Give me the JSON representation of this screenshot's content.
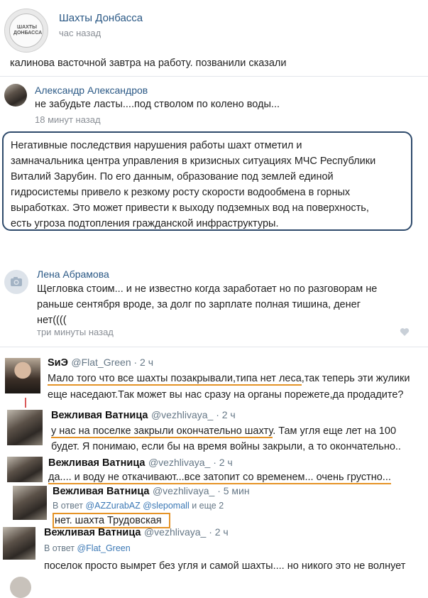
{
  "post1": {
    "author": "Шахты Донбасса",
    "logo_text": "ШАХТЫ ДОНБАССА",
    "time": "час назад",
    "text": "калинова васточной завтра на работу. позванили сказали"
  },
  "comment1": {
    "author": "Александр Александров",
    "text": "не забудьте ласты....под стволом по колено воды...",
    "time": "18 минут назад"
  },
  "quote": {
    "lines": [
      "Негативные последствия нарушения работы шахт отметил и",
      "замначальника центра управления в кризисных ситуациях МЧС Республики",
      "Виталий Зарубин. По его данным, образование под землей единой",
      "гидросистемы привело к резкому росту скорости водообмена в горных",
      "выработках. Это может привести к выходу подземных вод на поверхность,",
      "есть угроза подтопления гражданской инфраструктуры."
    ]
  },
  "comment2": {
    "author": "Лена Абрамова",
    "lines": [
      "Щегловка стоим... и не известно когда заработает но по разговорам не",
      "раньше сентября вроде, за долг по зарплате полная тишина, денег",
      "нет(((("
    ],
    "time": "три минуты назад"
  },
  "tweet1": {
    "name": "SиЭ",
    "handle": "@Flat_Green · 2 ч",
    "line1_underlined": "Мало того что все шахты позакрывали,типа нет леса",
    "line1_rest": ",так теперь эти жулики",
    "line2": "еще наседают.Так может вы нас сразу на органы порежете,да продадите?"
  },
  "tweet2": {
    "name": "Вежливая Ватница",
    "handle": "@vezhlivaya_ · 2 ч",
    "line1_underlined": "у нас на поселке закрыли окончательно шахту",
    "line1_rest": ". Там угля еще лет на 100",
    "line2": "будет. Я понимаю, если бы на время войны закрыли, а то окончательно.."
  },
  "tweet3": {
    "name": "Вежливая Ватница",
    "handle": "@vezhlivaya_ · 2 ч",
    "text": "да.... и воду не откачивают...все затопит со временем... очень грустно..."
  },
  "tweet4": {
    "name": "Вежливая Ватница",
    "handle": "@vezhlivaya_ · 5 мин",
    "reply_prefix": "В ответ",
    "reply_users": "@AZZurabAZ @slepomall",
    "reply_suffix": "и еще 2",
    "text": "нет. шахта Трудовская"
  },
  "tweet5": {
    "name": "Вежливая Ватница",
    "handle": "@vezhlivaya_ · 2 ч",
    "reply_prefix": "В ответ",
    "reply_users": "@Flat_Green",
    "text": "поселок просто вымрет без угля и самой шахты.... но никого это не волнует"
  },
  "colors": {
    "vk_blue": "#2a5885",
    "highlight": "#e59326",
    "link": "#3b78b5"
  }
}
